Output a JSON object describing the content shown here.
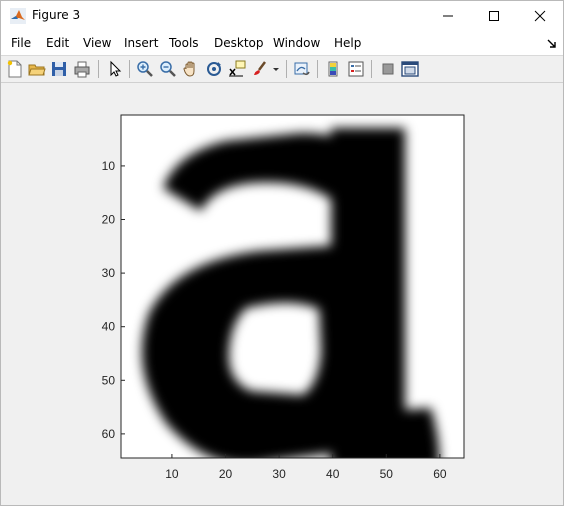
{
  "window": {
    "title": "Figure 3"
  },
  "menu": [
    "File",
    "Edit",
    "View",
    "Insert",
    "Tools",
    "Desktop",
    "Window",
    "Help"
  ],
  "toolbar_icons": [
    "new-figure-icon",
    "open-file-icon",
    "save-icon",
    "print-icon",
    "pointer-icon",
    "zoom-in-icon",
    "zoom-out-icon",
    "pan-icon",
    "rotate-3d-icon",
    "data-cursor-icon",
    "brush-icon",
    "link-plot-icon",
    "colorbar-icon",
    "legend-icon",
    "plot-tools-hide-icon",
    "plot-tools-show-icon"
  ],
  "chart_data": {
    "type": "heatmap",
    "colormap": "gray",
    "xlim": [
      0.5,
      64.5
    ],
    "ylim": [
      0.5,
      64.5
    ],
    "x_ticks": [
      10,
      20,
      30,
      40,
      50,
      60
    ],
    "y_ticks": [
      10,
      20,
      30,
      40,
      50,
      60
    ],
    "y_direction": "reverse",
    "image_content": "grayscale bitmap of lowercase letter a"
  }
}
